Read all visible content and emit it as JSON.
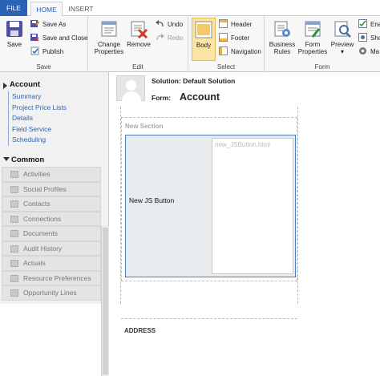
{
  "tabs": {
    "file": "FILE",
    "home": "HOME",
    "insert": "INSERT"
  },
  "ribbon": {
    "save": {
      "save": "Save",
      "save_as": "Save As",
      "save_close": "Save and Close",
      "publish": "Publish",
      "label": "Save"
    },
    "edit": {
      "change_properties": "Change Properties",
      "remove": "Remove",
      "undo": "Undo",
      "redo": "Redo",
      "label": "Edit"
    },
    "select": {
      "body": "Body",
      "header": "Header",
      "footer": "Footer",
      "navigation": "Navigation",
      "label": "Select"
    },
    "form": {
      "business_rules": "Business Rules",
      "form_properties": "Form Properties",
      "preview": "Preview",
      "enable": "Ena",
      "show": "Sho",
      "manage": "Ma",
      "label": "Form"
    }
  },
  "nav": {
    "account": "Account",
    "links": [
      "Summary",
      "Project Price Lists",
      "Details",
      "Field Service",
      "Scheduling"
    ],
    "common": "Common",
    "common_items": [
      "Activities",
      "Social Profiles",
      "Contacts",
      "Connections",
      "Documents",
      "Audit History",
      "Actuals",
      "Resource Preferences",
      "Opportunity Lines"
    ]
  },
  "main": {
    "solution": "Solution: Default Solution",
    "form_label": "Form:",
    "form_name": "Account",
    "section_title": "New Section",
    "field_label": "New JS Button",
    "field_control": "new_JSButton.html",
    "address": "ADDRESS"
  },
  "colors": {
    "file_tab": "#2a62b4",
    "link": "#2d63b0",
    "selected": "#fbe4a6",
    "field_border": "#4a7fc1"
  }
}
